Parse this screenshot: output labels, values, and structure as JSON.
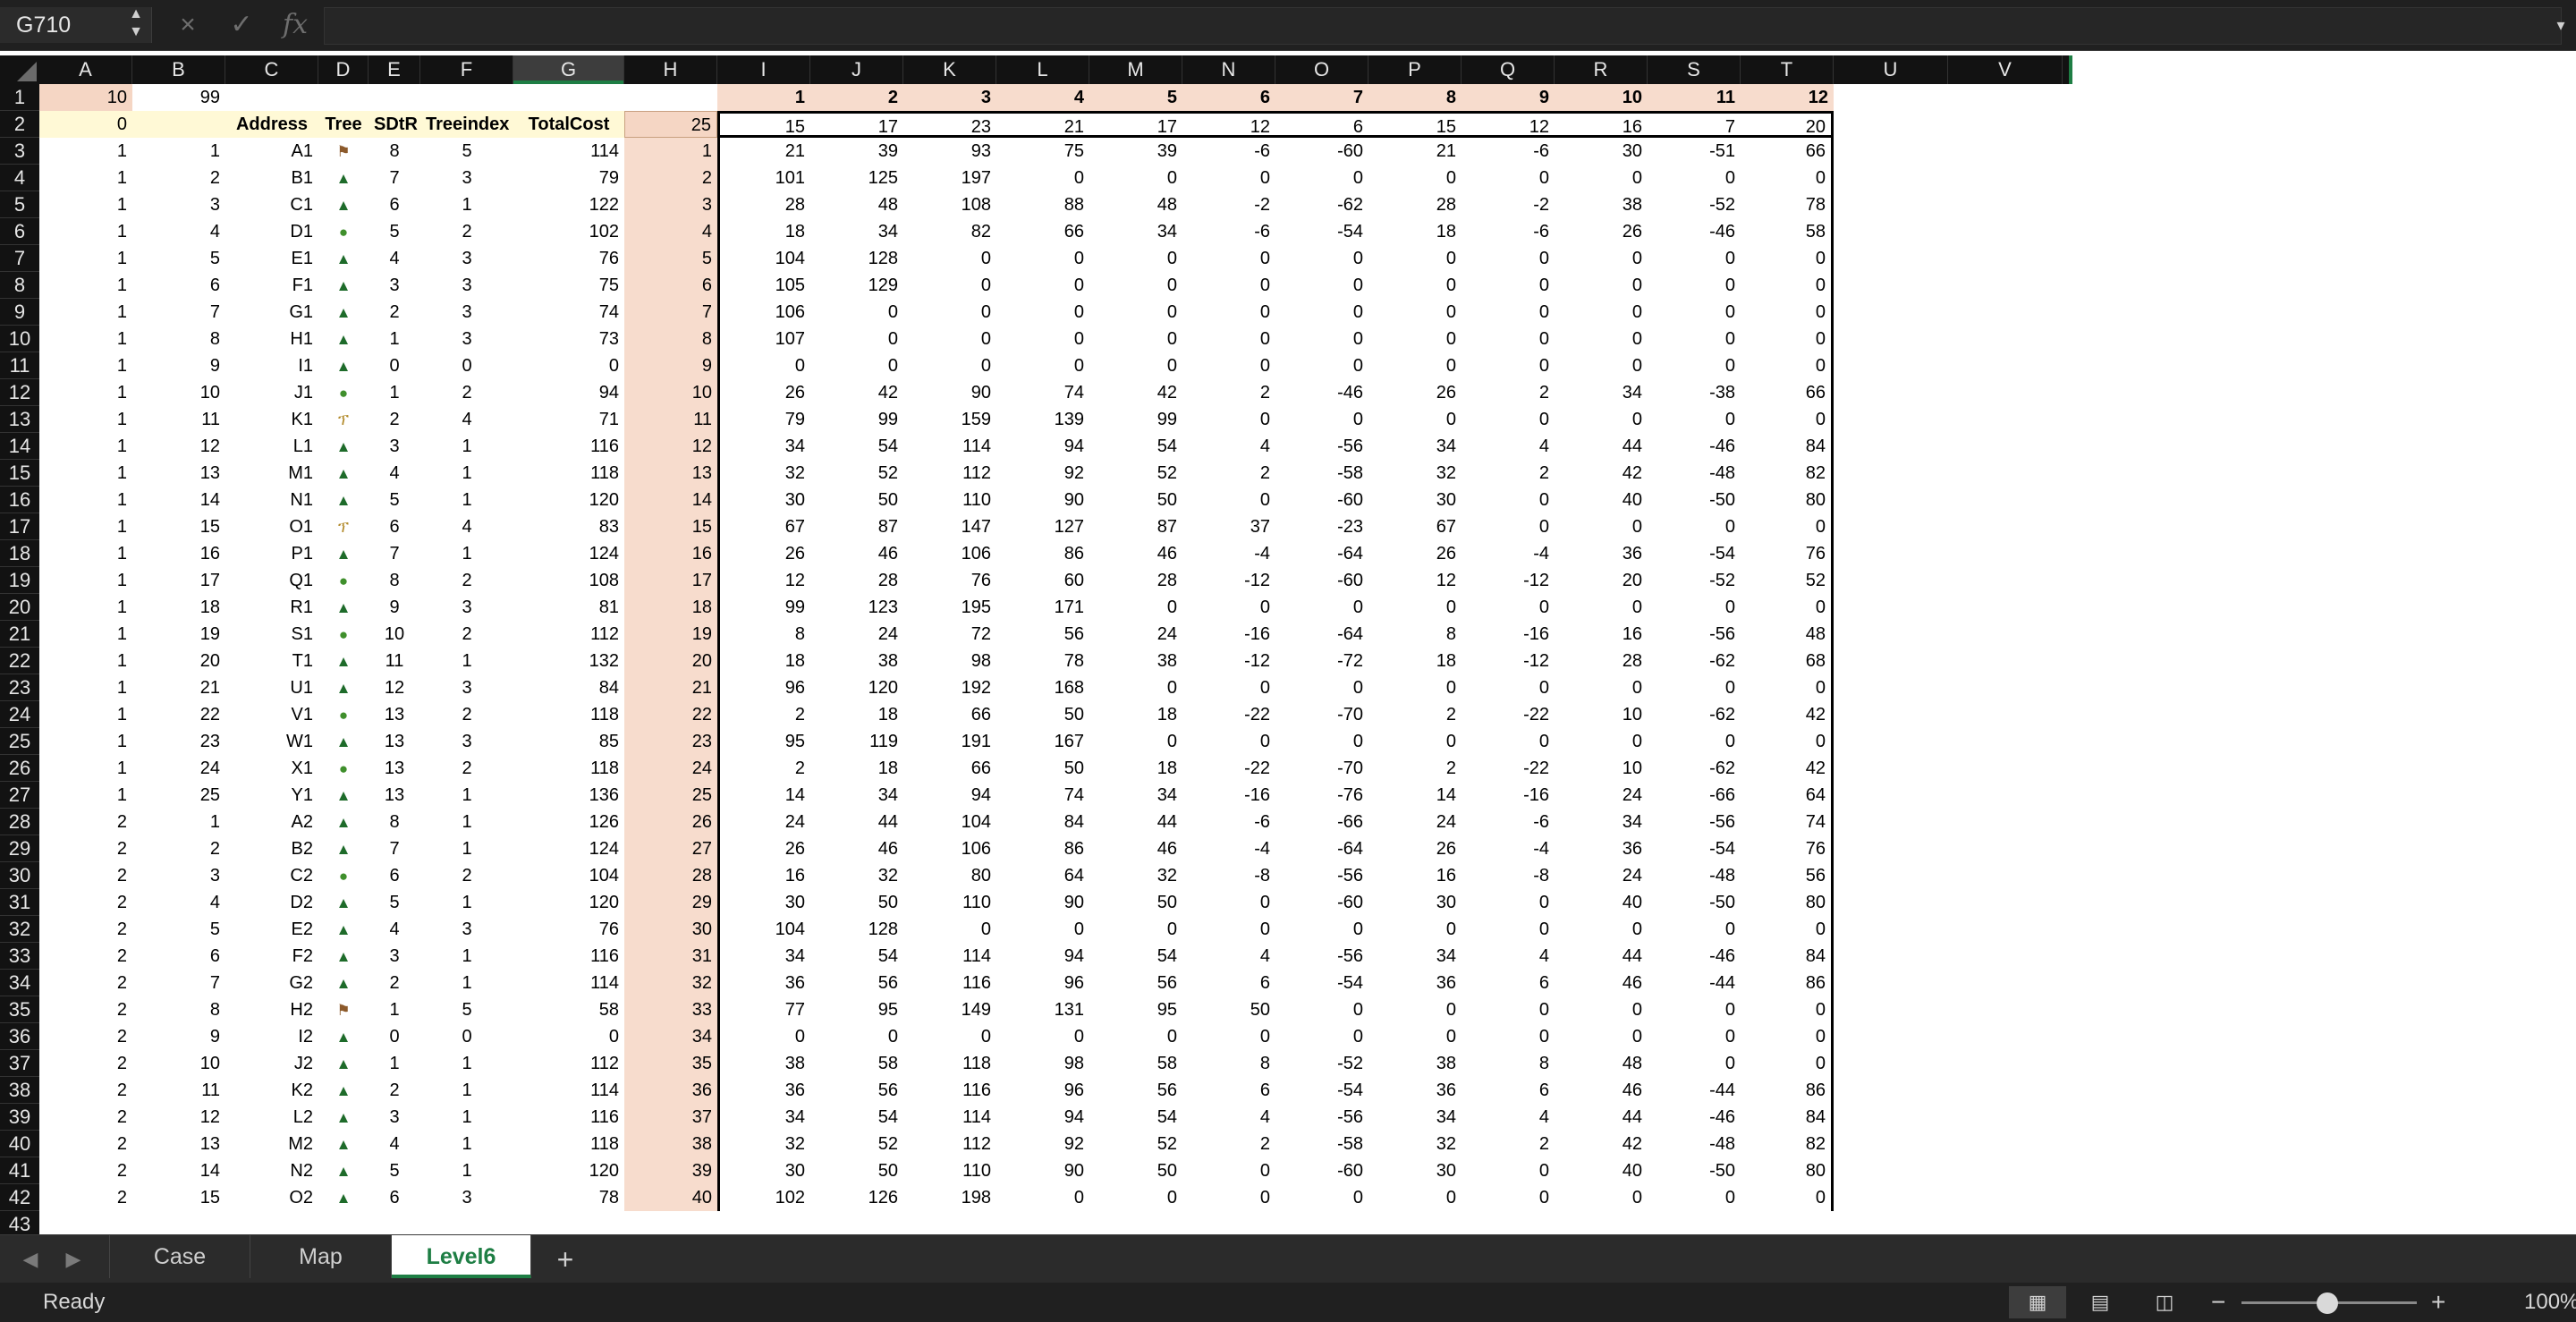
{
  "namebox": "G710",
  "formula_icons": {
    "cancel": "×",
    "enter": "✓",
    "function": "fx"
  },
  "columns": [
    "A",
    "B",
    "C",
    "D",
    "E",
    "F",
    "G",
    "H",
    "I",
    "J",
    "K",
    "L",
    "M",
    "N",
    "O",
    "P",
    "Q",
    "R",
    "S",
    "T",
    "U",
    "V"
  ],
  "row1": {
    "A": "10",
    "B": "99",
    "I": "1",
    "J": "2",
    "K": "3",
    "L": "4",
    "M": "5",
    "N": "6",
    "O": "7",
    "P": "8",
    "Q": "9",
    "R": "10",
    "S": "11",
    "T": "12"
  },
  "row2": {
    "A": "0",
    "C": "Address",
    "D": "Tree",
    "E": "SDtR",
    "F": "Treeindex",
    "G": "TotalCost",
    "H": "25",
    "I": "15",
    "J": "17",
    "K": "23",
    "L": "21",
    "M": "17",
    "N": "12",
    "O": "6",
    "P": "15",
    "Q": "12",
    "R": "16",
    "S": "7",
    "T": "20"
  },
  "rows": [
    [
      1,
      1,
      "A1",
      "stump",
      8,
      5,
      114,
      1,
      [
        21,
        39,
        93,
        75,
        39,
        -6,
        -60,
        21,
        -6,
        30,
        -51,
        66
      ]
    ],
    [
      1,
      2,
      "B1",
      "pine",
      7,
      3,
      79,
      2,
      [
        101,
        125,
        197,
        0,
        0,
        0,
        0,
        0,
        0,
        0,
        0,
        0
      ]
    ],
    [
      1,
      3,
      "C1",
      "pine",
      6,
      1,
      122,
      3,
      [
        28,
        48,
        108,
        88,
        48,
        -2,
        -62,
        28,
        -2,
        38,
        -52,
        78
      ]
    ],
    [
      1,
      4,
      "D1",
      "round",
      5,
      2,
      102,
      4,
      [
        18,
        34,
        82,
        66,
        34,
        -6,
        -54,
        18,
        -6,
        26,
        -46,
        58
      ]
    ],
    [
      1,
      5,
      "E1",
      "pine",
      4,
      3,
      76,
      5,
      [
        104,
        128,
        0,
        0,
        0,
        0,
        0,
        0,
        0,
        0,
        0,
        0
      ]
    ],
    [
      1,
      6,
      "F1",
      "pine",
      3,
      3,
      75,
      6,
      [
        105,
        129,
        0,
        0,
        0,
        0,
        0,
        0,
        0,
        0,
        0,
        0
      ]
    ],
    [
      1,
      7,
      "G1",
      "pine",
      2,
      3,
      74,
      7,
      [
        106,
        0,
        0,
        0,
        0,
        0,
        0,
        0,
        0,
        0,
        0,
        0
      ]
    ],
    [
      1,
      8,
      "H1",
      "pine",
      1,
      3,
      73,
      8,
      [
        107,
        0,
        0,
        0,
        0,
        0,
        0,
        0,
        0,
        0,
        0,
        0
      ]
    ],
    [
      1,
      9,
      "I1",
      "pine",
      0,
      0,
      0,
      9,
      [
        0,
        0,
        0,
        0,
        0,
        0,
        0,
        0,
        0,
        0,
        0,
        0
      ]
    ],
    [
      1,
      10,
      "J1",
      "round",
      1,
      2,
      94,
      10,
      [
        26,
        42,
        90,
        74,
        42,
        2,
        -46,
        26,
        2,
        34,
        -38,
        66
      ]
    ],
    [
      1,
      11,
      "K1",
      "palm",
      2,
      4,
      71,
      11,
      [
        79,
        99,
        159,
        139,
        99,
        0,
        0,
        0,
        0,
        0,
        0,
        0
      ]
    ],
    [
      1,
      12,
      "L1",
      "pine",
      3,
      1,
      116,
      12,
      [
        34,
        54,
        114,
        94,
        54,
        4,
        -56,
        34,
        4,
        44,
        -46,
        84
      ]
    ],
    [
      1,
      13,
      "M1",
      "pine",
      4,
      1,
      118,
      13,
      [
        32,
        52,
        112,
        92,
        52,
        2,
        -58,
        32,
        2,
        42,
        -48,
        82
      ]
    ],
    [
      1,
      14,
      "N1",
      "pine",
      5,
      1,
      120,
      14,
      [
        30,
        50,
        110,
        90,
        50,
        0,
        -60,
        30,
        0,
        40,
        -50,
        80
      ]
    ],
    [
      1,
      15,
      "O1",
      "palm",
      6,
      4,
      83,
      15,
      [
        67,
        87,
        147,
        127,
        87,
        37,
        -23,
        67,
        0,
        0,
        0,
        0
      ]
    ],
    [
      1,
      16,
      "P1",
      "pine",
      7,
      1,
      124,
      16,
      [
        26,
        46,
        106,
        86,
        46,
        -4,
        -64,
        26,
        -4,
        36,
        -54,
        76
      ]
    ],
    [
      1,
      17,
      "Q1",
      "round",
      8,
      2,
      108,
      17,
      [
        12,
        28,
        76,
        60,
        28,
        -12,
        -60,
        12,
        -12,
        20,
        -52,
        52
      ]
    ],
    [
      1,
      18,
      "R1",
      "pine",
      9,
      3,
      81,
      18,
      [
        99,
        123,
        195,
        171,
        0,
        0,
        0,
        0,
        0,
        0,
        0,
        0
      ]
    ],
    [
      1,
      19,
      "S1",
      "round",
      10,
      2,
      112,
      19,
      [
        8,
        24,
        72,
        56,
        24,
        -16,
        -64,
        8,
        -16,
        16,
        -56,
        48
      ]
    ],
    [
      1,
      20,
      "T1",
      "pine",
      11,
      1,
      132,
      20,
      [
        18,
        38,
        98,
        78,
        38,
        -12,
        -72,
        18,
        -12,
        28,
        -62,
        68
      ]
    ],
    [
      1,
      21,
      "U1",
      "pine",
      12,
      3,
      84,
      21,
      [
        96,
        120,
        192,
        168,
        0,
        0,
        0,
        0,
        0,
        0,
        0,
        0
      ]
    ],
    [
      1,
      22,
      "V1",
      "round",
      13,
      2,
      118,
      22,
      [
        2,
        18,
        66,
        50,
        18,
        -22,
        -70,
        2,
        -22,
        10,
        -62,
        42
      ]
    ],
    [
      1,
      23,
      "W1",
      "pine",
      13,
      3,
      85,
      23,
      [
        95,
        119,
        191,
        167,
        0,
        0,
        0,
        0,
        0,
        0,
        0,
        0
      ]
    ],
    [
      1,
      24,
      "X1",
      "round",
      13,
      2,
      118,
      24,
      [
        2,
        18,
        66,
        50,
        18,
        -22,
        -70,
        2,
        -22,
        10,
        -62,
        42
      ]
    ],
    [
      1,
      25,
      "Y1",
      "pine",
      13,
      1,
      136,
      25,
      [
        14,
        34,
        94,
        74,
        34,
        -16,
        -76,
        14,
        -16,
        24,
        -66,
        64
      ]
    ],
    [
      2,
      1,
      "A2",
      "pine",
      8,
      1,
      126,
      26,
      [
        24,
        44,
        104,
        84,
        44,
        -6,
        -66,
        24,
        -6,
        34,
        -56,
        74
      ]
    ],
    [
      2,
      2,
      "B2",
      "pine",
      7,
      1,
      124,
      27,
      [
        26,
        46,
        106,
        86,
        46,
        -4,
        -64,
        26,
        -4,
        36,
        -54,
        76
      ]
    ],
    [
      2,
      3,
      "C2",
      "round",
      6,
      2,
      104,
      28,
      [
        16,
        32,
        80,
        64,
        32,
        -8,
        -56,
        16,
        -8,
        24,
        -48,
        56
      ]
    ],
    [
      2,
      4,
      "D2",
      "pine",
      5,
      1,
      120,
      29,
      [
        30,
        50,
        110,
        90,
        50,
        0,
        -60,
        30,
        0,
        40,
        -50,
        80
      ]
    ],
    [
      2,
      5,
      "E2",
      "pine",
      4,
      3,
      76,
      30,
      [
        104,
        128,
        0,
        0,
        0,
        0,
        0,
        0,
        0,
        0,
        0,
        0
      ]
    ],
    [
      2,
      6,
      "F2",
      "pine",
      3,
      1,
      116,
      31,
      [
        34,
        54,
        114,
        94,
        54,
        4,
        -56,
        34,
        4,
        44,
        -46,
        84
      ]
    ],
    [
      2,
      7,
      "G2",
      "pine",
      2,
      1,
      114,
      32,
      [
        36,
        56,
        116,
        96,
        56,
        6,
        -54,
        36,
        6,
        46,
        -44,
        86
      ]
    ],
    [
      2,
      8,
      "H2",
      "stump",
      1,
      5,
      58,
      33,
      [
        77,
        95,
        149,
        131,
        95,
        50,
        0,
        0,
        0,
        0,
        0,
        0
      ]
    ],
    [
      2,
      9,
      "I2",
      "pine",
      0,
      0,
      0,
      34,
      [
        0,
        0,
        0,
        0,
        0,
        0,
        0,
        0,
        0,
        0,
        0,
        0
      ]
    ],
    [
      2,
      10,
      "J2",
      "pine",
      1,
      1,
      112,
      35,
      [
        38,
        58,
        118,
        98,
        58,
        8,
        -52,
        38,
        8,
        48,
        0,
        0
      ]
    ],
    [
      2,
      11,
      "K2",
      "pine",
      2,
      1,
      114,
      36,
      [
        36,
        56,
        116,
        96,
        56,
        6,
        -54,
        36,
        6,
        46,
        -44,
        86
      ]
    ],
    [
      2,
      12,
      "L2",
      "pine",
      3,
      1,
      116,
      37,
      [
        34,
        54,
        114,
        94,
        54,
        4,
        -56,
        34,
        4,
        44,
        -46,
        84
      ]
    ],
    [
      2,
      13,
      "M2",
      "pine",
      4,
      1,
      118,
      38,
      [
        32,
        52,
        112,
        92,
        52,
        2,
        -58,
        32,
        2,
        42,
        -48,
        82
      ]
    ],
    [
      2,
      14,
      "N2",
      "pine",
      5,
      1,
      120,
      39,
      [
        30,
        50,
        110,
        90,
        50,
        0,
        -60,
        30,
        0,
        40,
        -50,
        80
      ]
    ],
    [
      2,
      15,
      "O2",
      "pine",
      6,
      3,
      78,
      40,
      [
        102,
        126,
        198,
        0,
        0,
        0,
        0,
        0,
        0,
        0,
        0,
        0
      ]
    ]
  ],
  "tree_glyphs": {
    "pine": "▲",
    "round": "●",
    "palm": "ፕ",
    "stump": "⚑"
  },
  "tabs": [
    {
      "label": "Case",
      "active": false
    },
    {
      "label": "Map",
      "active": false
    },
    {
      "label": "Level6",
      "active": true
    }
  ],
  "add_tab": "+",
  "status": "Ready",
  "zoom": {
    "minus": "−",
    "plus": "+",
    "label": "100%",
    "level_percent": 100
  }
}
